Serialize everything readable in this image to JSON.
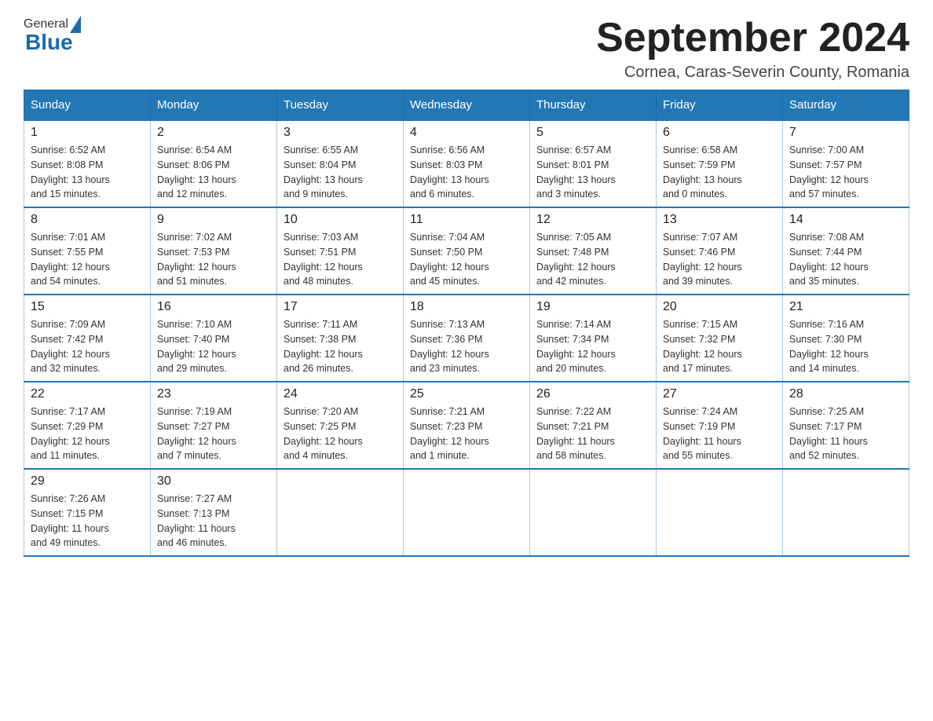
{
  "logo": {
    "general": "General",
    "blue": "Blue"
  },
  "title": "September 2024",
  "subtitle": "Cornea, Caras-Severin County, Romania",
  "days_of_week": [
    "Sunday",
    "Monday",
    "Tuesday",
    "Wednesday",
    "Thursday",
    "Friday",
    "Saturday"
  ],
  "weeks": [
    [
      {
        "day": "1",
        "info": "Sunrise: 6:52 AM\nSunset: 8:08 PM\nDaylight: 13 hours\nand 15 minutes."
      },
      {
        "day": "2",
        "info": "Sunrise: 6:54 AM\nSunset: 8:06 PM\nDaylight: 13 hours\nand 12 minutes."
      },
      {
        "day": "3",
        "info": "Sunrise: 6:55 AM\nSunset: 8:04 PM\nDaylight: 13 hours\nand 9 minutes."
      },
      {
        "day": "4",
        "info": "Sunrise: 6:56 AM\nSunset: 8:03 PM\nDaylight: 13 hours\nand 6 minutes."
      },
      {
        "day": "5",
        "info": "Sunrise: 6:57 AM\nSunset: 8:01 PM\nDaylight: 13 hours\nand 3 minutes."
      },
      {
        "day": "6",
        "info": "Sunrise: 6:58 AM\nSunset: 7:59 PM\nDaylight: 13 hours\nand 0 minutes."
      },
      {
        "day": "7",
        "info": "Sunrise: 7:00 AM\nSunset: 7:57 PM\nDaylight: 12 hours\nand 57 minutes."
      }
    ],
    [
      {
        "day": "8",
        "info": "Sunrise: 7:01 AM\nSunset: 7:55 PM\nDaylight: 12 hours\nand 54 minutes."
      },
      {
        "day": "9",
        "info": "Sunrise: 7:02 AM\nSunset: 7:53 PM\nDaylight: 12 hours\nand 51 minutes."
      },
      {
        "day": "10",
        "info": "Sunrise: 7:03 AM\nSunset: 7:51 PM\nDaylight: 12 hours\nand 48 minutes."
      },
      {
        "day": "11",
        "info": "Sunrise: 7:04 AM\nSunset: 7:50 PM\nDaylight: 12 hours\nand 45 minutes."
      },
      {
        "day": "12",
        "info": "Sunrise: 7:05 AM\nSunset: 7:48 PM\nDaylight: 12 hours\nand 42 minutes."
      },
      {
        "day": "13",
        "info": "Sunrise: 7:07 AM\nSunset: 7:46 PM\nDaylight: 12 hours\nand 39 minutes."
      },
      {
        "day": "14",
        "info": "Sunrise: 7:08 AM\nSunset: 7:44 PM\nDaylight: 12 hours\nand 35 minutes."
      }
    ],
    [
      {
        "day": "15",
        "info": "Sunrise: 7:09 AM\nSunset: 7:42 PM\nDaylight: 12 hours\nand 32 minutes."
      },
      {
        "day": "16",
        "info": "Sunrise: 7:10 AM\nSunset: 7:40 PM\nDaylight: 12 hours\nand 29 minutes."
      },
      {
        "day": "17",
        "info": "Sunrise: 7:11 AM\nSunset: 7:38 PM\nDaylight: 12 hours\nand 26 minutes."
      },
      {
        "day": "18",
        "info": "Sunrise: 7:13 AM\nSunset: 7:36 PM\nDaylight: 12 hours\nand 23 minutes."
      },
      {
        "day": "19",
        "info": "Sunrise: 7:14 AM\nSunset: 7:34 PM\nDaylight: 12 hours\nand 20 minutes."
      },
      {
        "day": "20",
        "info": "Sunrise: 7:15 AM\nSunset: 7:32 PM\nDaylight: 12 hours\nand 17 minutes."
      },
      {
        "day": "21",
        "info": "Sunrise: 7:16 AM\nSunset: 7:30 PM\nDaylight: 12 hours\nand 14 minutes."
      }
    ],
    [
      {
        "day": "22",
        "info": "Sunrise: 7:17 AM\nSunset: 7:29 PM\nDaylight: 12 hours\nand 11 minutes."
      },
      {
        "day": "23",
        "info": "Sunrise: 7:19 AM\nSunset: 7:27 PM\nDaylight: 12 hours\nand 7 minutes."
      },
      {
        "day": "24",
        "info": "Sunrise: 7:20 AM\nSunset: 7:25 PM\nDaylight: 12 hours\nand 4 minutes."
      },
      {
        "day": "25",
        "info": "Sunrise: 7:21 AM\nSunset: 7:23 PM\nDaylight: 12 hours\nand 1 minute."
      },
      {
        "day": "26",
        "info": "Sunrise: 7:22 AM\nSunset: 7:21 PM\nDaylight: 11 hours\nand 58 minutes."
      },
      {
        "day": "27",
        "info": "Sunrise: 7:24 AM\nSunset: 7:19 PM\nDaylight: 11 hours\nand 55 minutes."
      },
      {
        "day": "28",
        "info": "Sunrise: 7:25 AM\nSunset: 7:17 PM\nDaylight: 11 hours\nand 52 minutes."
      }
    ],
    [
      {
        "day": "29",
        "info": "Sunrise: 7:26 AM\nSunset: 7:15 PM\nDaylight: 11 hours\nand 49 minutes."
      },
      {
        "day": "30",
        "info": "Sunrise: 7:27 AM\nSunset: 7:13 PM\nDaylight: 11 hours\nand 46 minutes."
      },
      null,
      null,
      null,
      null,
      null
    ]
  ]
}
